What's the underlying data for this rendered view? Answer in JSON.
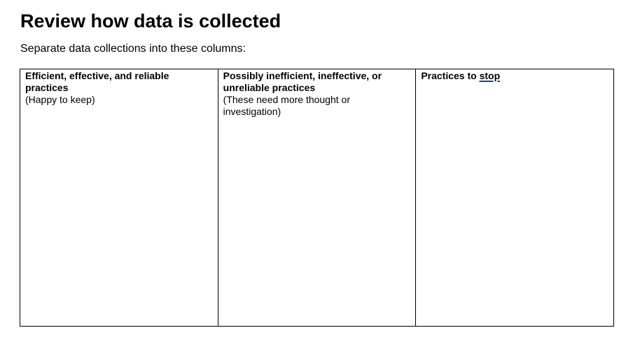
{
  "document": {
    "title": "Review how data is collected",
    "intro": "Separate data collections into these columns:"
  },
  "table": {
    "columns": [
      {
        "heading": "Efficient, effective, and reliable practices",
        "note": "(Happy to keep)"
      },
      {
        "heading": "Possibly inefficient, ineffective, or unreliable practices",
        "note": "(These need more thought or investigation)"
      },
      {
        "heading_prefix": "Practices to ",
        "heading_emphasis": "stop",
        "note": ""
      }
    ]
  },
  "colors": {
    "text": "#000000",
    "border": "#000000",
    "underline_accent": "#1f3a93"
  }
}
